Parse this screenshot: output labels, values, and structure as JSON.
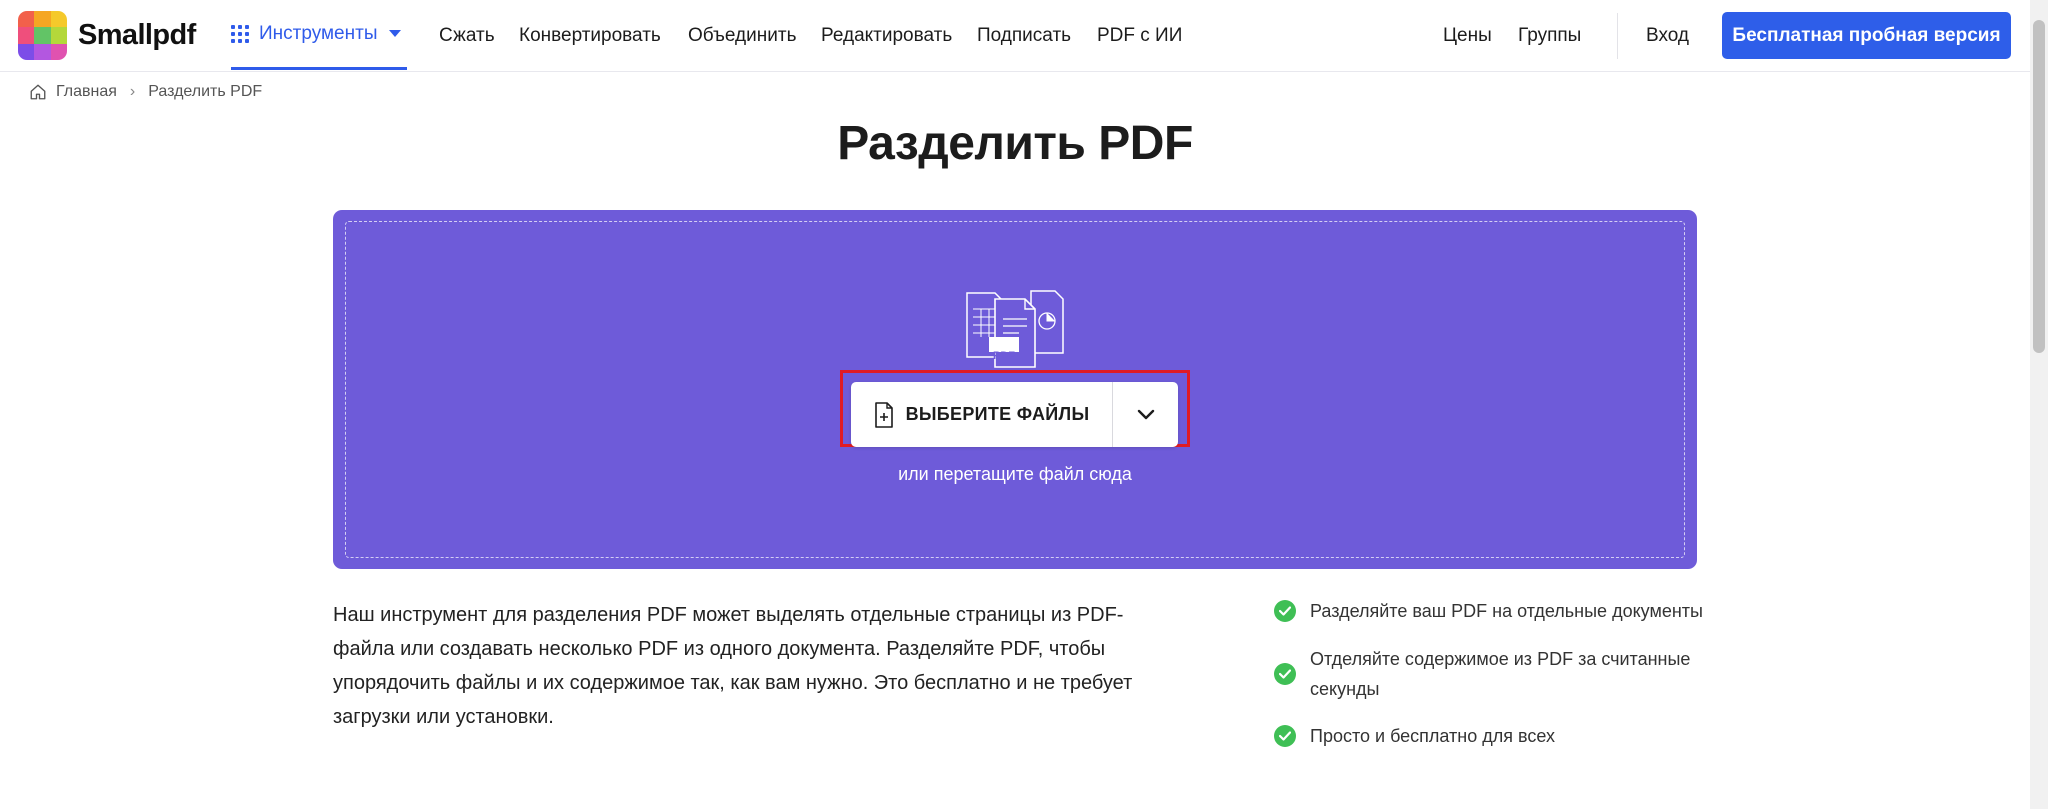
{
  "header": {
    "logo_text": "Smallpdf",
    "logo_colors": [
      "#f2604b",
      "#f5a623",
      "#f5c92b",
      "#4ea6f3",
      "#62c466",
      "#b4d83a",
      "#7c4de8",
      "#b357e0",
      "#e052b0"
    ],
    "tools_label": "Инструменты",
    "nav": [
      {
        "label": "Сжать"
      },
      {
        "label": "Конвертировать"
      },
      {
        "label": "Объединить"
      },
      {
        "label": "Редактировать"
      },
      {
        "label": "Подписать"
      },
      {
        "label": "PDF с ИИ"
      }
    ],
    "prices_label": "Цены",
    "groups_label": "Группы",
    "login_label": "Вход",
    "cta_label": "Бесплатная пробная версия",
    "accent_color": "#2e5ee9"
  },
  "breadcrumb": {
    "home": "Главная",
    "current": "Разделить PDF"
  },
  "title": "Разделить PDF",
  "dropzone": {
    "background": "#6e5bd9",
    "icon_badge": "PDF",
    "select_label": "ВЫБЕРИТЕ ФАЙЛЫ",
    "hint": "или перетащите файл сюда"
  },
  "description": "Наш инструмент для разделения PDF может выделять отдельные страницы из PDF-файла или создавать несколько PDF из одного документа. Разделяйте PDF, чтобы упорядочить файлы и их содержимое так, как вам нужно. Это бесплатно и не требует загрузки или установки.",
  "features": [
    {
      "text": "Разделяйте ваш PDF на отдельные документы"
    },
    {
      "text": "Отделяйте содержимое из PDF за считанные секунды"
    },
    {
      "text": "Просто и бесплатно для всех"
    }
  ]
}
